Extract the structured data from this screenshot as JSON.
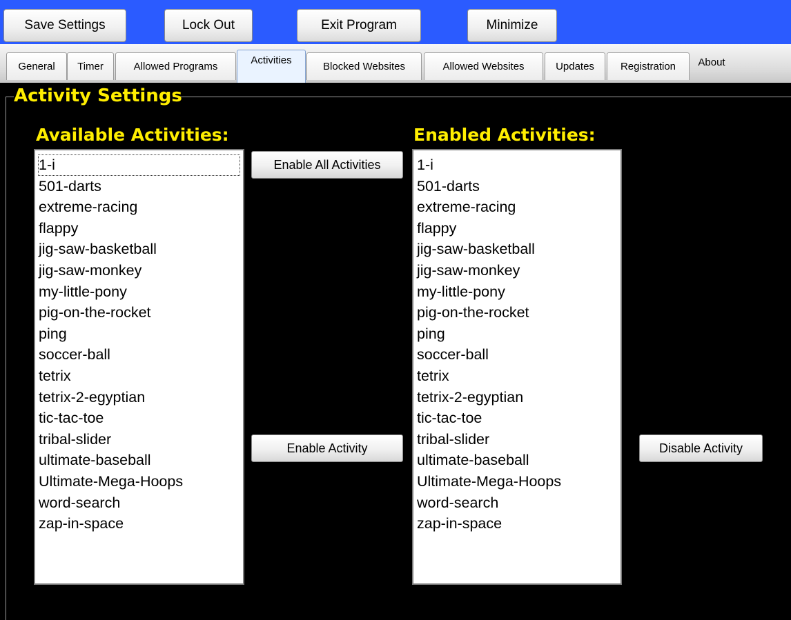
{
  "toolbar": {
    "buttons": [
      "Save Settings",
      "Lock Out",
      "Exit Program",
      "Minimize"
    ]
  },
  "tabs": [
    {
      "label": "General"
    },
    {
      "label": "Timer"
    },
    {
      "label": "Allowed Programs"
    },
    {
      "label": "Activities",
      "selected": true
    },
    {
      "label": "Blocked Websites"
    },
    {
      "label": "Allowed Websites"
    },
    {
      "label": "Updates"
    },
    {
      "label": "Registration"
    },
    {
      "label": "About"
    }
  ],
  "section_title": "Activity Settings",
  "available": {
    "label": "Available Activities:",
    "items": [
      "1-i",
      "501-darts",
      "extreme-racing",
      "flappy",
      "jig-saw-basketball",
      "jig-saw-monkey",
      "my-little-pony",
      "pig-on-the-rocket",
      "ping",
      "soccer-ball",
      "tetrix",
      "tetrix-2-egyptian",
      "tic-tac-toe",
      "tribal-slider",
      "ultimate-baseball",
      "Ultimate-Mega-Hoops",
      "word-search",
      "zap-in-space"
    ]
  },
  "enabled": {
    "label": "Enabled Activities:",
    "items": [
      "1-i",
      "501-darts",
      "extreme-racing",
      "flappy",
      "jig-saw-basketball",
      "jig-saw-monkey",
      "my-little-pony",
      "pig-on-the-rocket",
      "ping",
      "soccer-ball",
      "tetrix",
      "tetrix-2-egyptian",
      "tic-tac-toe",
      "tribal-slider",
      "ultimate-baseball",
      "Ultimate-Mega-Hoops",
      "word-search",
      "zap-in-space"
    ]
  },
  "actions": {
    "enable_all": "Enable All Activities",
    "enable": "Enable Activity",
    "disable": "Disable Activity"
  },
  "colors": {
    "toolbar_bg": "#2b5bff",
    "label_yellow": "#ffee00",
    "panel_bg": "#000000"
  }
}
